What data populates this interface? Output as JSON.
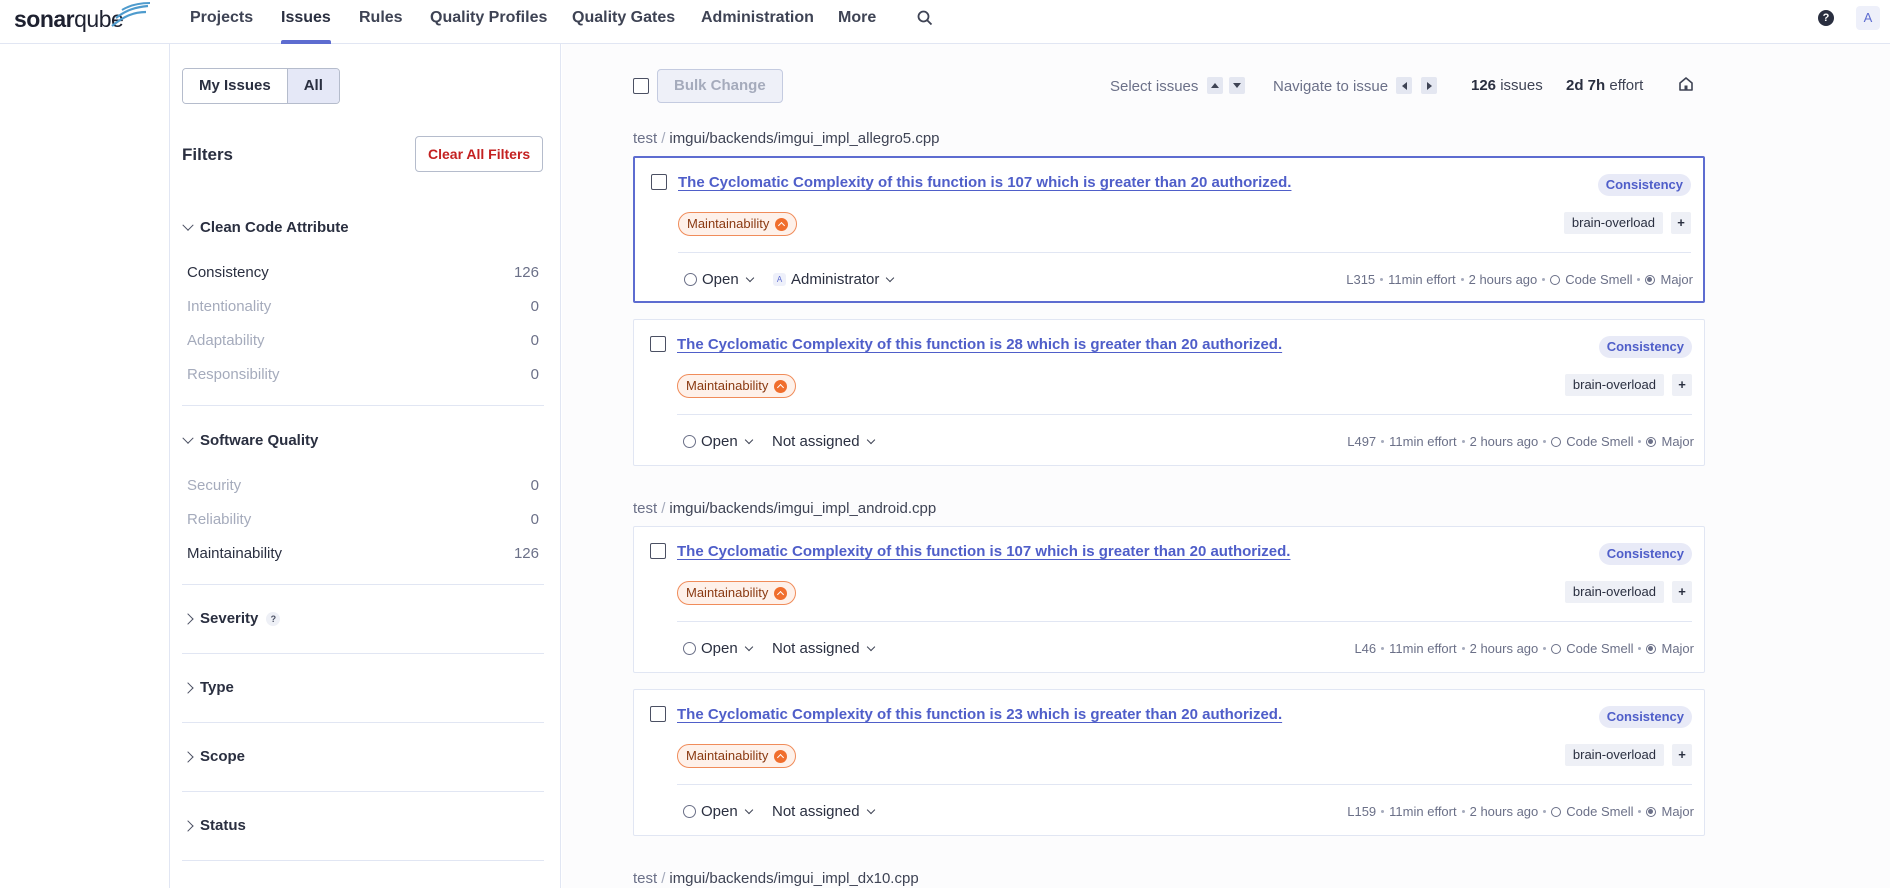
{
  "brand": {
    "name_a": "sonar",
    "name_b": "qube"
  },
  "nav": {
    "items": [
      {
        "label": "Projects",
        "name": "nav-projects"
      },
      {
        "label": "Issues",
        "name": "nav-issues"
      },
      {
        "label": "Rules",
        "name": "nav-rules"
      },
      {
        "label": "Quality Profiles",
        "name": "nav-quality-profiles"
      },
      {
        "label": "Quality Gates",
        "name": "nav-quality-gates"
      },
      {
        "label": "Administration",
        "name": "nav-administration"
      },
      {
        "label": "More",
        "name": "nav-more"
      }
    ],
    "active": "Issues",
    "help_label": "?",
    "avatar_initial": "A"
  },
  "sidebar": {
    "my_issues": "My Issues",
    "all": "All",
    "filters_title": "Filters",
    "clear_all": "Clear All Filters",
    "clean_code_attribute": {
      "title": "Clean Code Attribute",
      "items": [
        {
          "label": "Consistency",
          "count": "126"
        },
        {
          "label": "Intentionality",
          "count": "0"
        },
        {
          "label": "Adaptability",
          "count": "0"
        },
        {
          "label": "Responsibility",
          "count": "0"
        }
      ]
    },
    "software_quality": {
      "title": "Software Quality",
      "items": [
        {
          "label": "Security",
          "count": "0"
        },
        {
          "label": "Reliability",
          "count": "0"
        },
        {
          "label": "Maintainability",
          "count": "126"
        }
      ]
    },
    "severity": "Severity",
    "severity_help": "?",
    "type": "Type",
    "scope": "Scope",
    "status": "Status"
  },
  "toolbar": {
    "bulk_change": "Bulk Change",
    "select_issues": "Select issues",
    "navigate": "Navigate to issue",
    "issue_count": "126",
    "issues_label": "issues",
    "effort": "2d 7h",
    "effort_label": "effort"
  },
  "groups": [
    {
      "project": "test",
      "path": "imgui/backends/imgui_impl_allegro5.cpp",
      "issues": [
        {
          "title": "The Cyclomatic Complexity of this function is 107 which is greater than 20 authorized.",
          "attribute": "Consistency",
          "quality": "Maintainability",
          "tag": "brain-overload",
          "status": "Open",
          "assignee": "Administrator",
          "assignee_initial": "A",
          "line": "L315",
          "effort": "11min effort",
          "age": "2 hours ago",
          "type": "Code Smell",
          "severity": "Major"
        },
        {
          "title": "The Cyclomatic Complexity of this function is 28 which is greater than 20 authorized.",
          "attribute": "Consistency",
          "quality": "Maintainability",
          "tag": "brain-overload",
          "status": "Open",
          "assignee": "Not assigned",
          "line": "L497",
          "effort": "11min effort",
          "age": "2 hours ago",
          "type": "Code Smell",
          "severity": "Major"
        }
      ]
    },
    {
      "project": "test",
      "path": "imgui/backends/imgui_impl_android.cpp",
      "issues": [
        {
          "title": "The Cyclomatic Complexity of this function is 107 which is greater than 20 authorized.",
          "attribute": "Consistency",
          "quality": "Maintainability",
          "tag": "brain-overload",
          "status": "Open",
          "assignee": "Not assigned",
          "line": "L46",
          "effort": "11min effort",
          "age": "2 hours ago",
          "type": "Code Smell",
          "severity": "Major"
        },
        {
          "title": "The Cyclomatic Complexity of this function is 23 which is greater than 20 authorized.",
          "attribute": "Consistency",
          "quality": "Maintainability",
          "tag": "brain-overload",
          "status": "Open",
          "assignee": "Not assigned",
          "line": "L159",
          "effort": "11min effort",
          "age": "2 hours ago",
          "type": "Code Smell",
          "severity": "Major"
        }
      ]
    },
    {
      "project": "test",
      "path": "imgui/backends/imgui_impl_dx10.cpp",
      "issues": []
    }
  ],
  "colors": {
    "accent": "#5d6cd0",
    "link": "#4f5ec9",
    "danger": "#c42121",
    "maintainability": "#f06e2d"
  }
}
